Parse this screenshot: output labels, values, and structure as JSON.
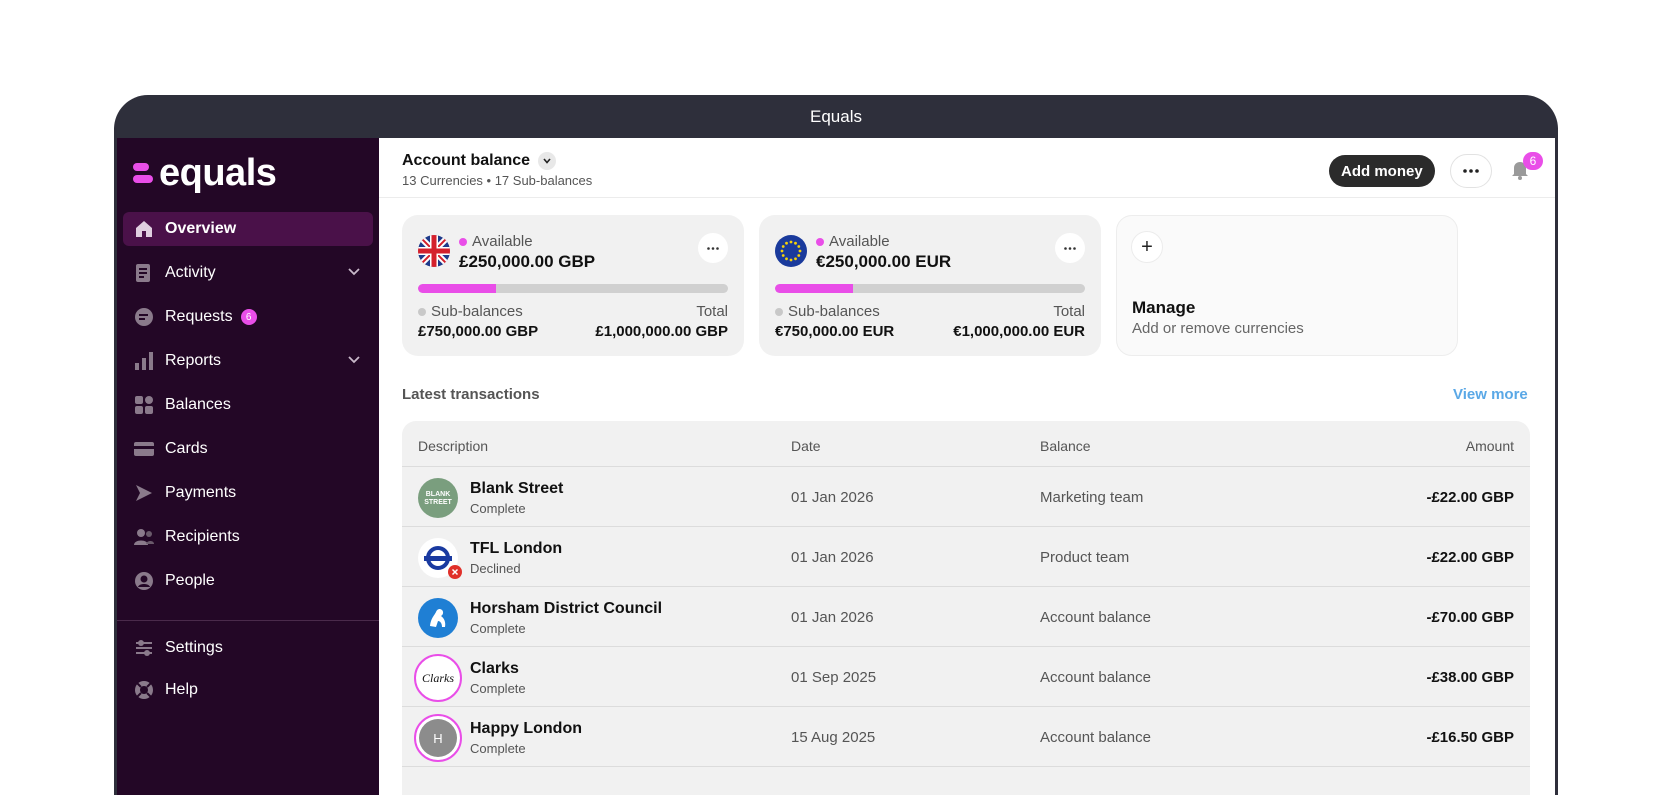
{
  "window": {
    "title": "Equals"
  },
  "brand": {
    "name": "equals"
  },
  "sidebar": {
    "items": [
      {
        "label": "Overview",
        "icon": "home-icon"
      },
      {
        "label": "Activity",
        "icon": "activity-icon"
      },
      {
        "label": "Requests",
        "icon": "requests-icon",
        "badge": "6"
      },
      {
        "label": "Reports",
        "icon": "reports-icon"
      },
      {
        "label": "Balances",
        "icon": "balances-icon"
      },
      {
        "label": "Cards",
        "icon": "card-icon"
      },
      {
        "label": "Payments",
        "icon": "payments-icon"
      },
      {
        "label": "Recipients",
        "icon": "recipients-icon"
      },
      {
        "label": "People",
        "icon": "person-icon"
      }
    ],
    "footer_items": [
      {
        "label": "Settings",
        "icon": "settings-icon"
      },
      {
        "label": "Help",
        "icon": "help-icon"
      }
    ]
  },
  "header": {
    "title": "Account balance",
    "subtitle": "13 Currencies • 17 Sub-balances",
    "add_money": "Add money",
    "notifications_count": "6"
  },
  "balances": [
    {
      "currency": "GBP",
      "available_label": "Available",
      "available": "£250,000.00 GBP",
      "progress": 0.25,
      "sub_label": "Sub-balances",
      "sub_value": "£750,000.00 GBP",
      "total_label": "Total",
      "total_value": "£1,000,000.00 GBP"
    },
    {
      "currency": "EUR",
      "available_label": "Available",
      "available": "€250,000.00 EUR",
      "progress": 0.25,
      "sub_label": "Sub-balances",
      "sub_value": "€750,000.00 EUR",
      "total_label": "Total",
      "total_value": "€1,000,000.00 EUR"
    }
  ],
  "manage": {
    "title": "Manage",
    "subtitle": "Add or remove currencies"
  },
  "transactions": {
    "title": "Latest transactions",
    "view_more": "View more",
    "columns": [
      "Description",
      "Date",
      "Balance",
      "Amount"
    ],
    "rows": [
      {
        "name": "Blank Street",
        "status": "Complete",
        "date": "01 Jan 2026",
        "balance": "Marketing team",
        "amount": "-£22.00 GBP",
        "logo_text": "BLANK STREET"
      },
      {
        "name": "TFL London",
        "status": "Declined",
        "date": "01 Jan 2026",
        "balance": "Product team",
        "amount": "-£22.00 GBP",
        "logo_text": ""
      },
      {
        "name": "Horsham District Council",
        "status": "Complete",
        "date": "01 Jan 2026",
        "balance": "Account balance",
        "amount": "-£70.00 GBP",
        "logo_text": ""
      },
      {
        "name": "Clarks",
        "status": "Complete",
        "date": "01 Sep 2025",
        "balance": "Account balance",
        "amount": "-£38.00 GBP",
        "logo_text": "Clarks"
      },
      {
        "name": "Happy London",
        "status": "Complete",
        "date": "15 Aug 2025",
        "balance": "Account balance",
        "amount": "-£16.50 GBP",
        "logo_text": "H"
      }
    ]
  },
  "colors": {
    "accent": "#e94ee8",
    "sidebar_bg": "#230726",
    "link": "#5aa8e6"
  }
}
